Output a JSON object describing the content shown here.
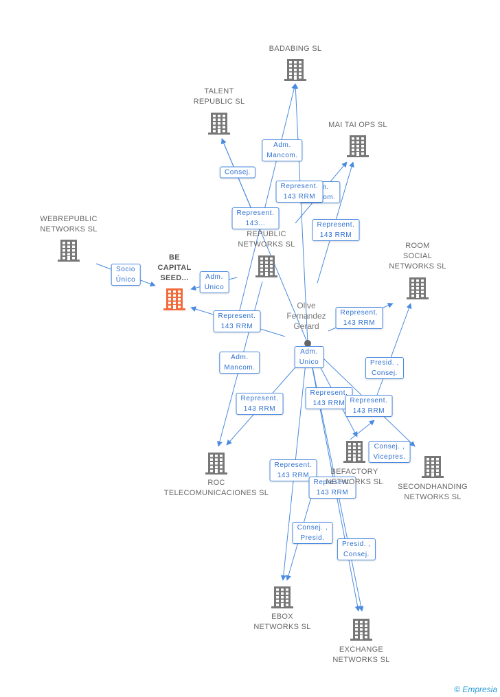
{
  "colors": {
    "edge": "#4a8ae0",
    "company": "#777777",
    "focus": "#f26b3a"
  },
  "nodes": [
    {
      "id": "badabing",
      "label": "BADABING SL"
    },
    {
      "id": "talent",
      "label": "TALENT\nREPUBLIC SL"
    },
    {
      "id": "maitai",
      "label": "MAI TAI OPS SL"
    },
    {
      "id": "webrepublic",
      "label": "WEBREPUBLIC\nNETWORKS SL"
    },
    {
      "id": "becapital",
      "label": "BE\nCAPITAL\nSEED..."
    },
    {
      "id": "republic",
      "label": "REPUBLIC\nNETWORKS SL"
    },
    {
      "id": "roomsocial",
      "label": "ROOM\nSOCIAL\nNETWORKS SL"
    },
    {
      "id": "roc",
      "label": "ROC\nTELECOMUNICACIONES SL"
    },
    {
      "id": "befactory",
      "label": "BEFACTORY\nNETWORKS SL"
    },
    {
      "id": "secondhanding",
      "label": "SECONDHANDING\nNETWORKS SL"
    },
    {
      "id": "ebox",
      "label": "EBOX\nNETWORKS SL"
    },
    {
      "id": "exchange",
      "label": "EXCHANGE\nNETWORKS SL"
    }
  ],
  "person": {
    "label": "Olive\nFernandez\nGerard"
  },
  "edge_labels": [
    "Adm.\nMancom.",
    "Consej.",
    "Adm.\nMancom.",
    "Represent.\n143 RRM",
    "Represent.\n143...",
    "Represent.\n143 RRM",
    "Socio\nÚnico",
    "Adm.\nUnico",
    "Represent.\n143 RRM",
    "Represent.\n143 RRM",
    "Adm.\nMancom.",
    "Adm.\nUnico",
    "Presid. ,\nConsej.",
    "Represent.\n143 RRM",
    "Represent.\n143 RRM",
    "Represent.\n143 RRM",
    "Consej. ,\nVicepres.",
    "Represent.\n143 RRM",
    "Represent.\n143 RRM",
    "Consej. ,\nPresid.",
    "Presid. ,\nConsej."
  ],
  "footer": {
    "copyright": "©",
    "brand": "Empresia"
  }
}
